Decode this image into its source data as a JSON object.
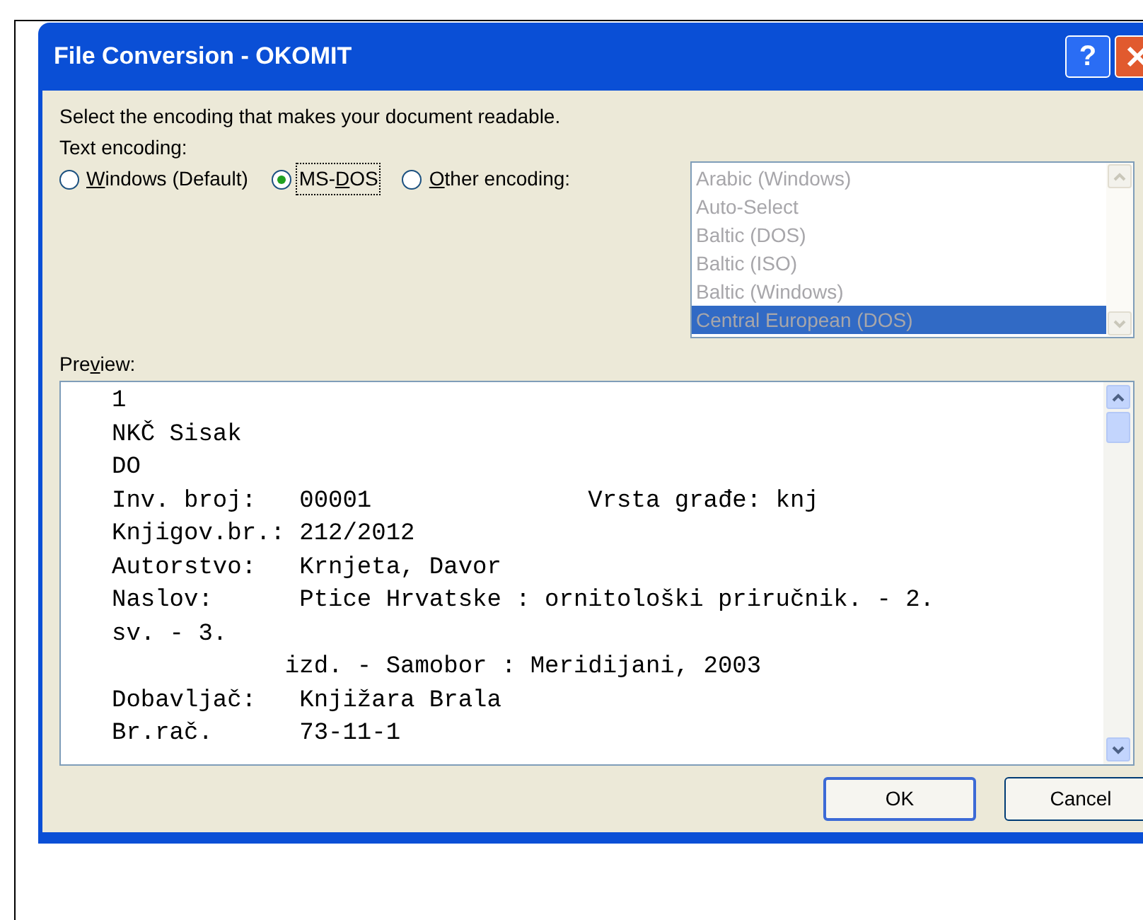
{
  "window": {
    "title": "File Conversion - OKOMIT",
    "help_button": "?"
  },
  "instruction": "Select the encoding that makes your document readable.",
  "encoding_label": "Text encoding:",
  "encoding_options": [
    {
      "key": "W",
      "rest": "indows (Default)",
      "selected": false
    },
    {
      "lead": "MS-",
      "key": "D",
      "rest": "OS",
      "selected": true
    },
    {
      "key": "O",
      "rest": "ther encoding:",
      "selected": false
    }
  ],
  "encoding_list": {
    "disabled": true,
    "items": [
      {
        "label": "Arabic (Windows)",
        "selected": false
      },
      {
        "label": "Auto-Select",
        "selected": false
      },
      {
        "label": "Baltic (DOS)",
        "selected": false
      },
      {
        "label": "Baltic (ISO)",
        "selected": false
      },
      {
        "label": "Baltic (Windows)",
        "selected": false
      },
      {
        "label": "Central European (DOS)",
        "selected": true
      }
    ]
  },
  "preview": {
    "label": {
      "lead": "Pre",
      "key": "v",
      "rest": "iew:"
    },
    "lines": [
      "1",
      "NKČ Sisak",
      "DO",
      "Inv. broj:   00001               Vrsta građe: knj",
      "Knjigov.br.: 212/2012",
      "Autorstvo:   Krnjeta, Davor",
      "Naslov:      Ptice Hrvatske : ornitološki priručnik. - 2.",
      "sv. - 3.",
      "            izd. - Samobor : Meridijani, 2003",
      "Dobavljač:   Knjižara Brala",
      "Br.rač.      73-11-1"
    ]
  },
  "buttons": [
    "OK",
    "Cancel"
  ]
}
